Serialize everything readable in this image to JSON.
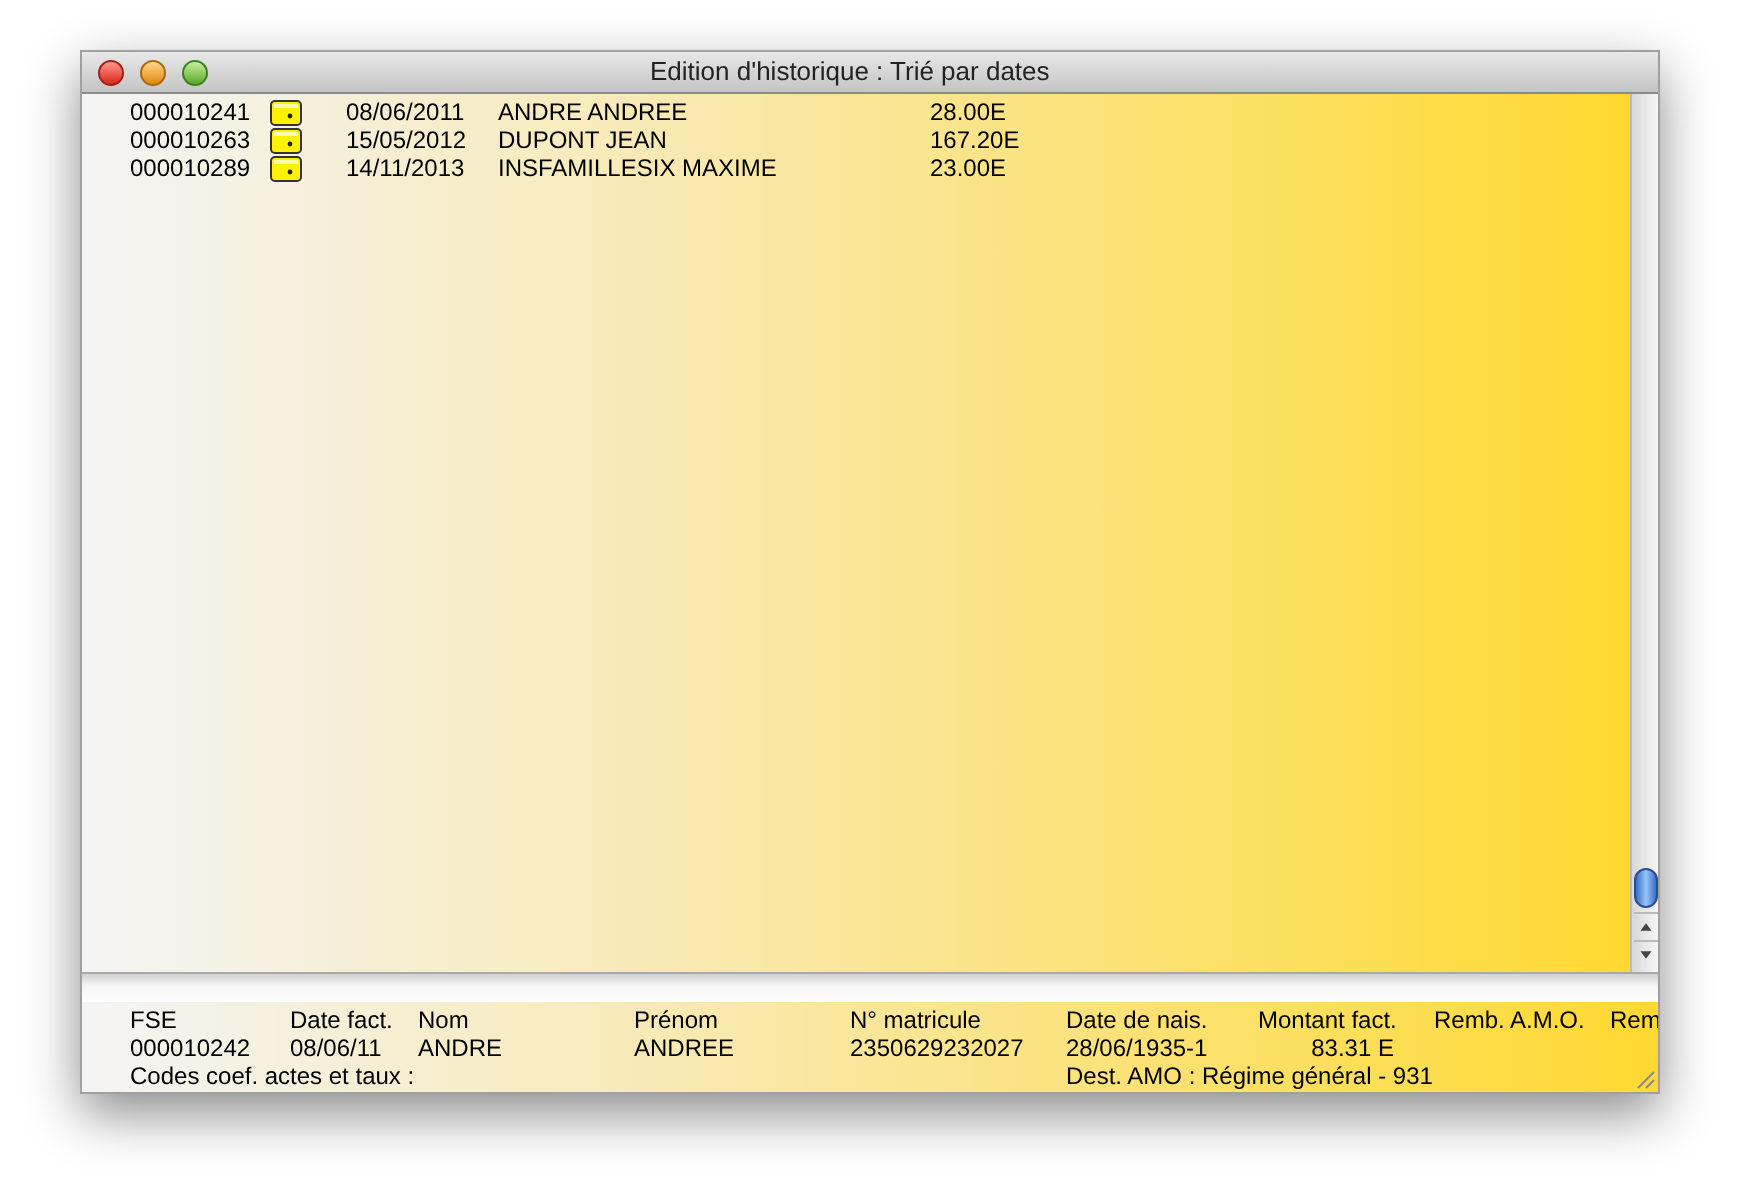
{
  "window": {
    "title": "Edition d'historique : Trié par dates"
  },
  "list": {
    "rows": [
      {
        "number": "000010241",
        "date": "08/06/2011",
        "name": "ANDRE ANDREE",
        "amount": "28.00E"
      },
      {
        "number": "000010263",
        "date": "15/05/2012",
        "name": "DUPONT JEAN",
        "amount": "167.20E"
      },
      {
        "number": "000010289",
        "date": "14/11/2013",
        "name": "INSFAMILLESIX MAXIME",
        "amount": "23.00E"
      }
    ]
  },
  "detail": {
    "headers": [
      "FSE",
      "Date fact.",
      "Nom",
      "Prénom",
      "N° matricule",
      "Date de nais.",
      "Montant fact.",
      "Remb. A.M.O.",
      "Rem"
    ],
    "values": [
      "000010242",
      "08/06/11",
      "ANDRE",
      "ANDREE",
      "2350629232027",
      "28/06/1935-1",
      "83.31 E"
    ],
    "codes_label": "Codes coef. actes et taux :",
    "destination": "Dest. AMO : Régime général - 931"
  }
}
